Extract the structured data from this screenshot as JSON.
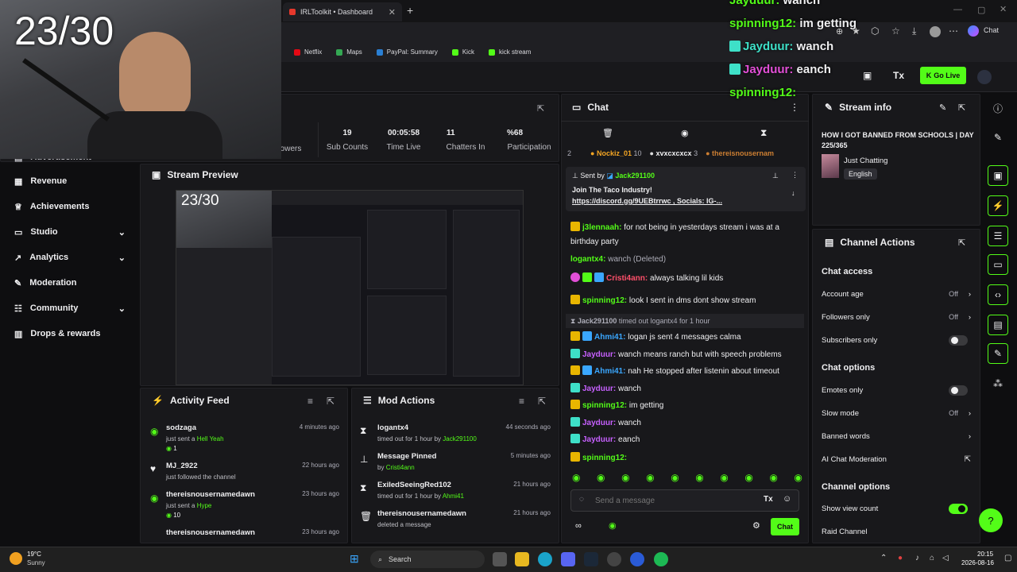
{
  "browser": {
    "tab_title": "IRLToolkit • Dashboard",
    "bookmarks": [
      "Netflix",
      "Maps",
      "PayPal: Summary",
      "Kick",
      "kick stream"
    ],
    "chat_button_label": "Chat"
  },
  "overlay": {
    "counter": "23/30",
    "chat_lines": [
      {
        "user": "Jayduur:",
        "text": "wanch",
        "color": "#53fc18"
      },
      {
        "user": "spinning12:",
        "text": "im getting",
        "color": "#53fc18"
      },
      {
        "user": "Jayduur:",
        "text": "wanch",
        "color": "#3ee0c8"
      },
      {
        "user": "Jayduur:",
        "text": "eanch",
        "color": "#e24fd7"
      },
      {
        "user": "spinning12:",
        "text": "",
        "color": "#53fc18"
      }
    ]
  },
  "header": {
    "go_live_label": "Go Live"
  },
  "stats": [
    {
      "value": "",
      "label": "owers"
    },
    {
      "value": "19",
      "label": "Sub Counts"
    },
    {
      "value": "00:05:58",
      "label": "Time Live"
    },
    {
      "value": "11",
      "label": "Chatters In"
    },
    {
      "value": "%68",
      "label": "Participation"
    }
  ],
  "sidebar": {
    "partial_top": "Advertisement",
    "items": [
      {
        "label": "Revenue",
        "has_chevron": false
      },
      {
        "label": "Achievements",
        "has_chevron": false
      },
      {
        "label": "Studio",
        "has_chevron": true
      },
      {
        "label": "Analytics",
        "has_chevron": true
      },
      {
        "label": "Moderation",
        "has_chevron": false
      },
      {
        "label": "Community",
        "has_chevron": true
      },
      {
        "label": "Drops & rewards",
        "has_chevron": false
      }
    ]
  },
  "stream_preview": {
    "title": "Stream Preview",
    "counter": "23/30"
  },
  "activity_feed": {
    "title": "Activity Feed",
    "items": [
      {
        "name": "sodzaga",
        "action": "just sent a",
        "highlight": "Hell Yeah",
        "amount": "1",
        "time": "4 minutes ago"
      },
      {
        "name": "MJ_2922",
        "action": "just followed the channel",
        "highlight": "",
        "amount": "",
        "time": "22 hours ago"
      },
      {
        "name": "thereisnousernamedawn",
        "action": "just sent a",
        "highlight": "Hype",
        "amount": "10",
        "time": "23 hours ago"
      },
      {
        "name": "thereisnousernamedawn",
        "action": "",
        "highlight": "",
        "amount": "",
        "time": "23 hours ago"
      }
    ]
  },
  "mod_actions": {
    "title": "Mod Actions",
    "items": [
      {
        "name": "logantx4",
        "detail": "timed out for 1 hour by",
        "by": "Jack291100",
        "time": "44 seconds ago"
      },
      {
        "name": "Message Pinned",
        "detail": "by",
        "by": "Cristi4ann",
        "time": "5 minutes ago"
      },
      {
        "name": "ExiledSeeingRed102",
        "detail": "timed out for 1 hour by",
        "by": "Ahmi41",
        "time": "21 hours ago"
      },
      {
        "name": "thereisnousernamedawn",
        "detail": "deleted a message",
        "by": "",
        "time": "21 hours ago"
      }
    ]
  },
  "chat": {
    "title": "Chat",
    "gifters": [
      {
        "rank": "2",
        "name": "",
        "count": ""
      },
      {
        "rank": "",
        "name": "Nockiz_01",
        "count": "10"
      },
      {
        "rank": "",
        "name": "xvxcxcxcx",
        "count": "3"
      },
      {
        "rank": "",
        "name": "thereisnousernam",
        "count": ""
      }
    ],
    "pinned": {
      "sent_by_label": "Sent by",
      "sender": "Jack291100",
      "line1": "Join The Taco Industry!",
      "line2": "https://discord.gg/9UEBtrrwc , Socials: IG-..."
    },
    "messages": [
      {
        "badge": "13",
        "user": "j3lennaah:",
        "color": "#53fc18",
        "text": "for not being in yesterdays stream i was at a birthday party"
      },
      {
        "badge": "",
        "user": "logantx4:",
        "color": "#53fc18",
        "text": "wanch (Deleted)"
      },
      {
        "badge": "",
        "user": "Cristi4ann:",
        "color": "#ff4f6a",
        "text": "always talking lil kids"
      },
      {
        "badge": "17",
        "user": "spinning12:",
        "color": "#53fc18",
        "text": "look I sent in dms dont show stream"
      },
      {
        "badge": "",
        "user": "Jack291100",
        "color": "#adadb8",
        "text": "timed out logantx4 for 1 hour"
      },
      {
        "badge": "18",
        "user": "Ahmi41:",
        "color": "#3aa7ff",
        "text": "logan js sent 4 messages calma"
      },
      {
        "badge": "",
        "user": "Jayduur:",
        "color": "#c760ff",
        "text": "wanch means ranch but with speech problems"
      },
      {
        "badge": "18",
        "user": "Ahmi41:",
        "color": "#3aa7ff",
        "text": "nah He stopped after listenin about timeout"
      },
      {
        "badge": "",
        "user": "Jayduur:",
        "color": "#c760ff",
        "text": "wanch"
      },
      {
        "badge": "17",
        "user": "spinning12:",
        "color": "#53fc18",
        "text": "im getting"
      },
      {
        "badge": "",
        "user": "Jayduur:",
        "color": "#c760ff",
        "text": "wanch"
      },
      {
        "badge": "",
        "user": "Jayduur:",
        "color": "#c760ff",
        "text": "eanch"
      },
      {
        "badge": "17",
        "user": "spinning12:",
        "color": "#53fc18",
        "text": ""
      }
    ],
    "input_placeholder": "Send a message",
    "send_label": "Chat"
  },
  "stream_info": {
    "title": "Stream info",
    "stream_title": "HOW I GOT BANNED FROM SCHOOLS | DAY 225/365",
    "category": "Just Chatting",
    "language": "English"
  },
  "channel_actions": {
    "title": "Channel Actions",
    "chat_access_title": "Chat access",
    "chat_access": [
      {
        "label": "Account age",
        "value": "Off",
        "type": "chevron"
      },
      {
        "label": "Followers only",
        "value": "Off",
        "type": "chevron"
      },
      {
        "label": "Subscribers only",
        "value": "",
        "type": "toggle-off"
      }
    ],
    "chat_options_title": "Chat options",
    "chat_options": [
      {
        "label": "Emotes only",
        "value": "",
        "type": "toggle-off"
      },
      {
        "label": "Slow mode",
        "value": "Off",
        "type": "chevron"
      },
      {
        "label": "Banned words",
        "value": "",
        "type": "chevron"
      },
      {
        "label": "AI Chat Moderation",
        "value": "",
        "type": "external"
      }
    ],
    "channel_options_title": "Channel options",
    "channel_options": [
      {
        "label": "Show view count",
        "value": "",
        "type": "toggle-on"
      },
      {
        "label": "Raid Channel",
        "value": "",
        "type": "none"
      }
    ]
  },
  "taskbar": {
    "weather_temp": "19°C",
    "weather_desc": "Sunny",
    "search_label": "Search",
    "time": "20:15",
    "date": "2026-08-16"
  },
  "colors": {
    "accent": "#53fc18",
    "panel_bg": "#18181b",
    "page_bg": "#0e0e10"
  }
}
